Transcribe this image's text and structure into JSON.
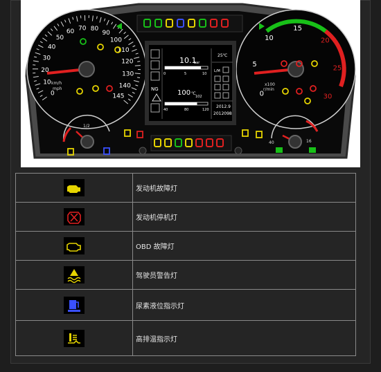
{
  "colors": {
    "page_bg": "#1e1e1e",
    "panel_bg": "#252525",
    "table_border": "#8a8a8a",
    "gauge_red": "#e02020",
    "indicator_green": "#18c018",
    "indicator_yellow": "#e6d400",
    "indicator_blue": "#3a50ff"
  },
  "dashboard": {
    "speedometer": {
      "ticks": [
        "0",
        "10",
        "20",
        "30",
        "40",
        "50",
        "60",
        "70",
        "80",
        "90",
        "100",
        "110",
        "120",
        "130",
        "140",
        "145"
      ],
      "unit_top": "km/h",
      "unit_bottom": "mph"
    },
    "tachometer": {
      "ticks": [
        "0",
        "5",
        "10",
        "15",
        "20",
        "25",
        "30"
      ],
      "unit_top": "x100",
      "unit_bottom": "r/min"
    },
    "fuel_gauge": {
      "mid_tick": "1/2"
    },
    "temp_gauge": {
      "ticks": [
        "40",
        "16"
      ]
    },
    "lcd": {
      "pressure_value": "10.1",
      "pressure_unit": "bar",
      "pressure_scale": [
        "0",
        "5",
        "10"
      ],
      "pressure_fill": 0.84,
      "temp_value": "100",
      "temp_unit": "℃",
      "temp_sub": "102",
      "temp_scale": [
        "40",
        "80",
        "120"
      ],
      "temp_fill": 0.75,
      "outside_temp": "25℃",
      "ng_label": "NG",
      "date_line1": "2012.9",
      "date_line2": "2012098",
      "lm_label": "L/M"
    }
  },
  "legend_rows": [
    {
      "icon": "engine-fault-icon",
      "label": "发动机故障灯"
    },
    {
      "icon": "engine-stop-icon",
      "label": "发动机停机灯"
    },
    {
      "icon": "obd-fault-icon",
      "label": "OBD 故障灯"
    },
    {
      "icon": "driver-warning-icon",
      "label": "驾驶员警告灯"
    },
    {
      "icon": "urea-level-icon",
      "label": "尿素液位指示灯"
    },
    {
      "icon": "high-exhaust-temp-icon",
      "label": "高排温指示灯"
    }
  ]
}
